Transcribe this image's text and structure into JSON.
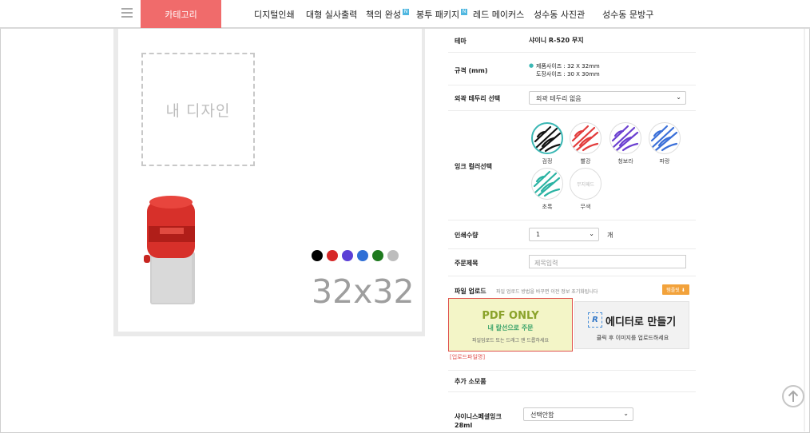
{
  "nav": {
    "category": "카테고리",
    "items": [
      "디지털인쇄",
      "대형 실사출력",
      "책의 완성",
      "봉투 패키지",
      "레드 메이커스",
      "성수동 사진관",
      "성수동 문방구"
    ],
    "badge": "N"
  },
  "preview": {
    "placeholder": "내 디자인",
    "size": "32x32",
    "swatch_colors": [
      "#000000",
      "#d62828",
      "#5b3fd6",
      "#2f6fd6",
      "#1f7a1f",
      "#bdbdbd"
    ]
  },
  "form": {
    "theme": {
      "label": "테마",
      "value": "샤이니 R-520 무지"
    },
    "spec": {
      "label": "규격 (mm)",
      "line1": "제품사이즈 : 32 X 32mm",
      "line2": "도장사이즈 : 30 X 30mm"
    },
    "border": {
      "label": "외곽 테두리 선택",
      "value": "외곽 테두리 없음"
    },
    "ink": {
      "label": "잉크 컬러선택",
      "options": [
        {
          "name": "검정",
          "color": "#111111"
        },
        {
          "name": "빨강",
          "color": "#e23b3b"
        },
        {
          "name": "청보라",
          "color": "#6a3fd0"
        },
        {
          "name": "파랑",
          "color": "#3a6fd8"
        },
        {
          "name": "초록",
          "color": "#2bb3a3"
        },
        {
          "name": "무색",
          "color": "",
          "inner": "무지패드"
        }
      ]
    },
    "quantity": {
      "label": "인쇄수량",
      "value": "1",
      "unit": "개"
    },
    "title": {
      "label": "주문제목",
      "placeholder": "제목입력"
    },
    "upload": {
      "label": "파일 업로드",
      "note": "파일 업로드 방법을 바꾸면 이전 정보 초기화됩니다",
      "help": "템플릿 ⬇",
      "pdf_title": "PDF ONLY",
      "pdf_sub": "내 칼선으로 주문",
      "pdf_hint": "파일업로드 또는 드래그 앤 드롭하세요",
      "editor_title": "에디터로 만들기",
      "editor_hint": "클릭 후 이미지를 업로드하세요",
      "editor_icon": "R",
      "filename": "[업로드파일명]"
    },
    "extra": {
      "label": "추가 소모품",
      "ink_label_1": "샤이니스페셜잉크",
      "ink_label_2": "28ml",
      "ink_select": "선택안함"
    }
  }
}
